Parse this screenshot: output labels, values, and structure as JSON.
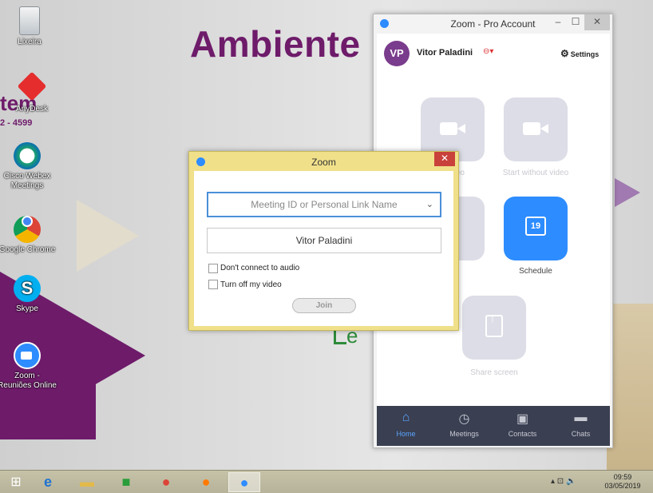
{
  "desktop": {
    "wallpaper_title": "Ambiente",
    "wallpaper_fragment": "tem",
    "wallpaper_phone": "2 - 4599",
    "icons": [
      {
        "label": "Lixeira",
        "icon": "recycle-bin-icon"
      },
      {
        "label": "AnyDesk",
        "icon": "anydesk-icon"
      },
      {
        "label": "Cisco Webex Meetings",
        "icon": "webex-icon"
      },
      {
        "label": "Google Chrome",
        "icon": "chrome-icon"
      },
      {
        "label": "Skype",
        "icon": "skype-icon"
      },
      {
        "label": "Zoom - Reuniões Online",
        "icon": "zoom-icon"
      }
    ]
  },
  "zoom_main": {
    "title": "Zoom - Pro Account",
    "avatar_initials": "VP",
    "user_name": "Vitor Paladini",
    "settings_label": "Settings",
    "tiles": {
      "new_meeting_label": "video",
      "start_without_video_label": "Start without video",
      "schedule_label": "Schedule",
      "schedule_day": "19",
      "share_screen_label": "Share screen"
    },
    "nav": [
      {
        "label": "Home",
        "icon": "home-icon",
        "glyph": "⌂"
      },
      {
        "label": "Meetings",
        "icon": "clock-icon",
        "glyph": "◷"
      },
      {
        "label": "Contacts",
        "icon": "contacts-icon",
        "glyph": "▣"
      },
      {
        "label": "Chats",
        "icon": "chat-icon",
        "glyph": "▬"
      }
    ]
  },
  "join_dialog": {
    "title": "Zoom",
    "meeting_placeholder": "Meeting ID or Personal Link Name",
    "name_value": "Vitor Paladini",
    "option_audio": "Don't connect to audio",
    "option_video": "Turn off my video",
    "join_label": "Join"
  },
  "taskbar": {
    "time": "09:59",
    "date": "03/05/2019"
  },
  "colors": {
    "zoom_blue": "#2d8cff",
    "brand_purple": "#6e1b6a",
    "dialog_frame": "#f0e08a",
    "nav_bg": "#3a3f51"
  }
}
